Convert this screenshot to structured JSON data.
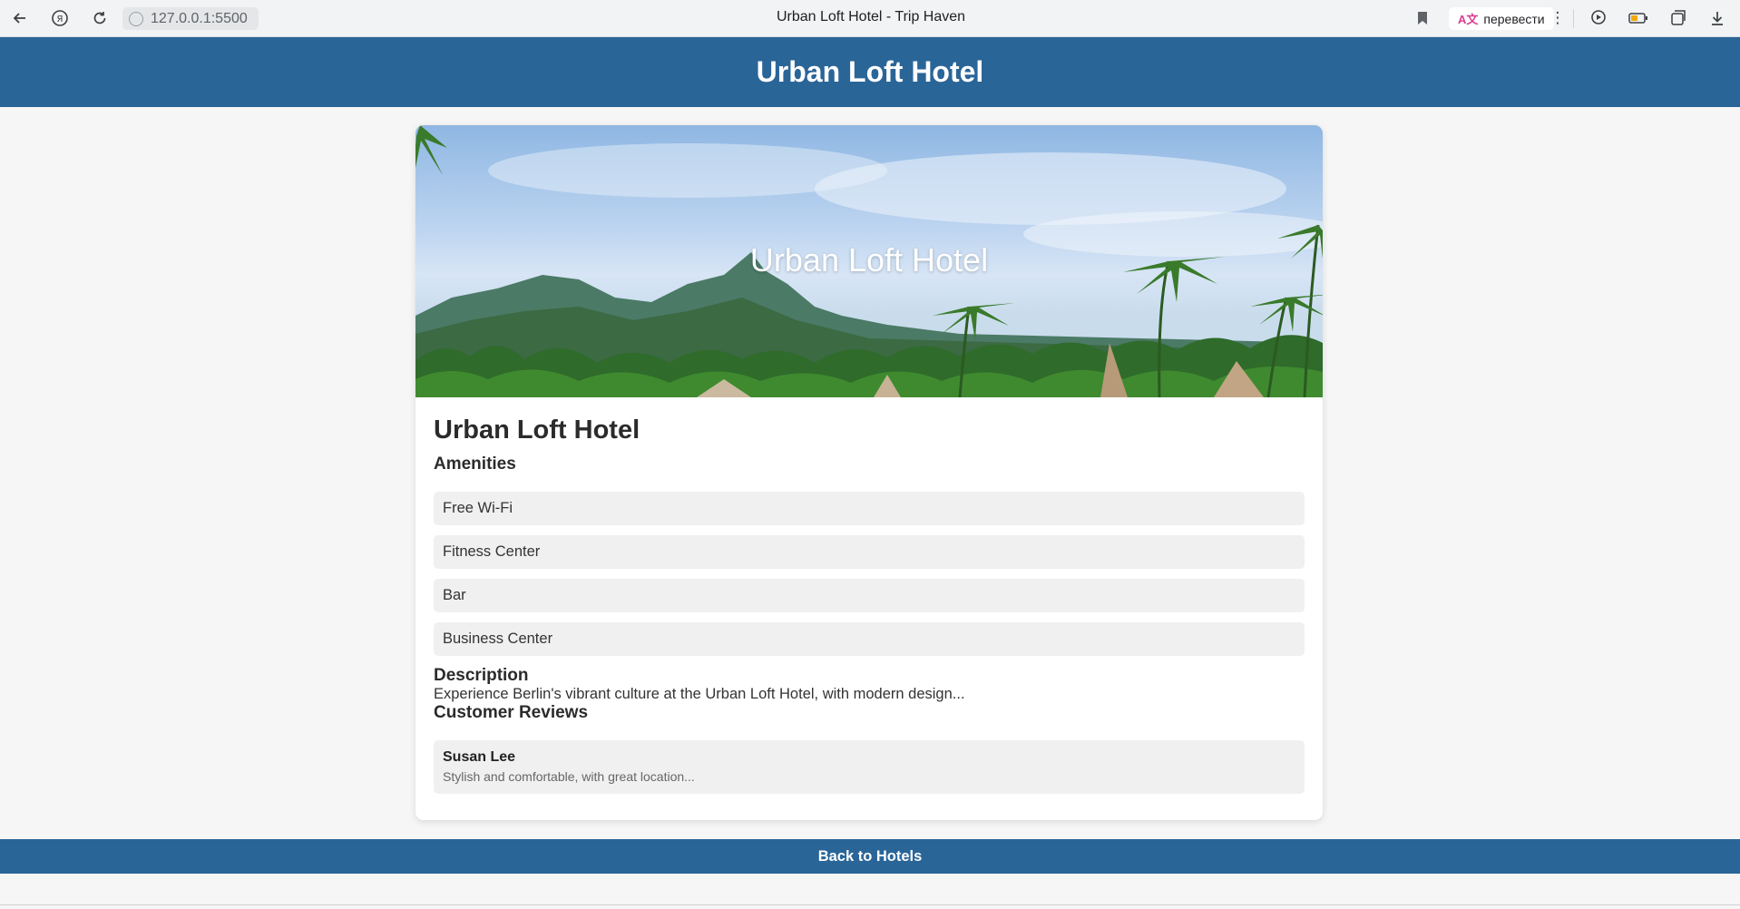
{
  "browser": {
    "address": "127.0.0.1:5500",
    "tab_title": "Urban Loft Hotel - Trip Haven",
    "translate_label": "перевести",
    "icons": [
      "back-icon",
      "yandex-icon",
      "reload-icon",
      "site-info-icon",
      "bookmark-icon",
      "more-icon",
      "media-icon",
      "battery-icon",
      "collections-icon",
      "download-icon"
    ]
  },
  "header": {
    "title": "Urban Loft Hotel"
  },
  "hotel": {
    "hero_title": "Urban Loft Hotel",
    "name": "Urban Loft Hotel",
    "amenities_heading": "Amenities",
    "amenities": [
      "Free Wi-Fi",
      "Fitness Center",
      "Bar",
      "Business Center"
    ],
    "description_heading": "Description",
    "description": "Experience Berlin's vibrant culture at the Urban Loft Hotel, with modern design...",
    "reviews_heading": "Customer Reviews",
    "reviews": [
      {
        "author": "Susan Lee",
        "text": "Stylish and comfortable, with great location..."
      }
    ]
  },
  "footer": {
    "back_label": "Back to Hotels"
  },
  "colors": {
    "brand": "#2a6598",
    "item_bg": "#f0f0f0",
    "page_bg": "#f6f6f6"
  }
}
